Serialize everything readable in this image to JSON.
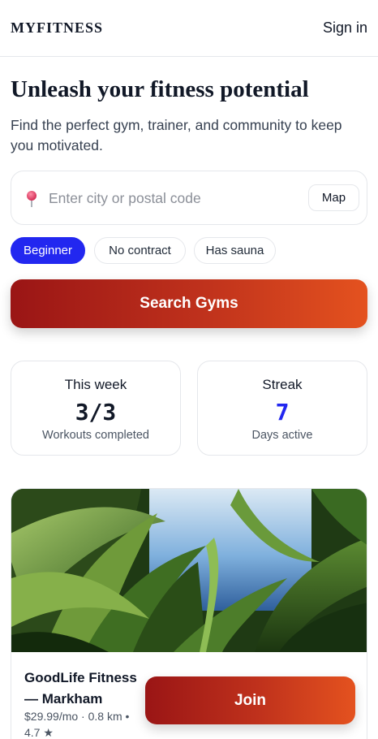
{
  "header": {
    "brand": "MYFITNESS",
    "sign_in_label": "Sign in"
  },
  "hero": {
    "title": "Unleash your fitness potential",
    "subtitle": "Find the perfect gym, trainer, and community to keep you motivated."
  },
  "search": {
    "placeholder": "Enter city or postal code",
    "value": "",
    "pin_icon": "map-pin-icon",
    "map_button_label": "Map"
  },
  "filters": [
    {
      "label": "Beginner",
      "active": true
    },
    {
      "label": "No contract",
      "active": false
    },
    {
      "label": "Has sauna",
      "active": false
    }
  ],
  "search_button_label": "Search Gyms",
  "stats": [
    {
      "label": "This week",
      "value": "3/3",
      "caption": "Workouts completed",
      "color": "#111827"
    },
    {
      "label": "Streak",
      "value": "7",
      "caption": "Days active",
      "color": "#2227f0"
    }
  ],
  "gym": {
    "name": "GoodLife Fitness — Markham",
    "meta": "$29.99/mo · 0.8 km • 4.7 ★",
    "join_label": "Join"
  },
  "colors": {
    "accent_blue": "#2227f0",
    "cta_gradient_start": "#9a1515",
    "cta_gradient_end": "#e4521f",
    "pin_color": "#e0456a"
  }
}
